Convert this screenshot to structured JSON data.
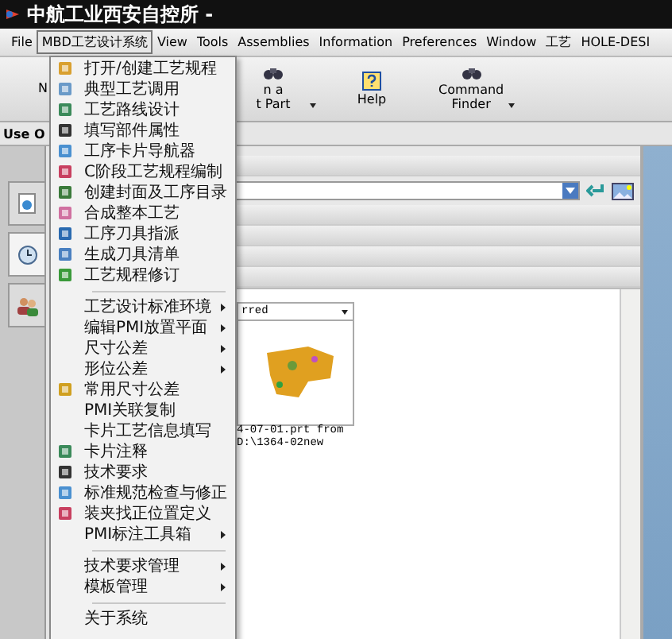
{
  "window": {
    "title": "中航工业西安自控所 -"
  },
  "menubar": [
    {
      "label": "File",
      "selected": false
    },
    {
      "label": "MBD工艺设计系统",
      "selected": true
    },
    {
      "label": "View",
      "selected": false
    },
    {
      "label": "Tools",
      "selected": false
    },
    {
      "label": "Assemblies",
      "selected": false
    },
    {
      "label": "Information",
      "selected": false
    },
    {
      "label": "Preferences",
      "selected": false
    },
    {
      "label": "Window",
      "selected": false
    },
    {
      "label": "工艺",
      "selected": false
    },
    {
      "label": "HOLE-DESI",
      "selected": false
    }
  ],
  "toolbar": [
    {
      "label": "N",
      "has_icon": false
    },
    {
      "label": "n a\nt Part",
      "has_icon": true,
      "dropdown": true
    },
    {
      "label": "Help",
      "has_icon": true,
      "dropdown": false
    },
    {
      "label": "Command\nFinder",
      "has_icon": true,
      "dropdown": true
    }
  ],
  "use_bar": {
    "label": "Use O"
  },
  "side_tabs": [
    {
      "selected": false
    },
    {
      "selected": true
    },
    {
      "selected": false
    }
  ],
  "dropdown_menu": {
    "groups": [
      [
        {
          "label": "打开/创建工艺规程",
          "has_icon": true,
          "submenu": false
        },
        {
          "label": "典型工艺调用",
          "has_icon": true,
          "submenu": false
        },
        {
          "label": "工艺路线设计",
          "has_icon": true,
          "submenu": false
        },
        {
          "label": "填写部件属性",
          "has_icon": true,
          "submenu": false
        },
        {
          "label": "工序卡片导航器",
          "has_icon": true,
          "submenu": false
        },
        {
          "label": "C阶段工艺规程编制",
          "has_icon": true,
          "submenu": false
        },
        {
          "label": "创建封面及工序目录",
          "has_icon": true,
          "submenu": false
        },
        {
          "label": "合成整本工艺",
          "has_icon": true,
          "submenu": false
        },
        {
          "label": "工序刀具指派",
          "has_icon": true,
          "submenu": false
        },
        {
          "label": "生成刀具清单",
          "has_icon": true,
          "submenu": false
        },
        {
          "label": "工艺规程修订",
          "has_icon": true,
          "submenu": false
        }
      ],
      [
        {
          "label": "工艺设计标准环境",
          "has_icon": false,
          "submenu": true
        },
        {
          "label": "编辑PMI放置平面",
          "has_icon": false,
          "submenu": true
        },
        {
          "label": "尺寸公差",
          "has_icon": false,
          "submenu": true
        },
        {
          "label": "形位公差",
          "has_icon": false,
          "submenu": true
        },
        {
          "label": "常用尺寸公差",
          "has_icon": true,
          "submenu": false
        },
        {
          "label": "PMI关联复制",
          "has_icon": false,
          "submenu": false
        },
        {
          "label": "卡片工艺信息填写",
          "has_icon": false,
          "submenu": false
        },
        {
          "label": "卡片注释",
          "has_icon": true,
          "submenu": false
        },
        {
          "label": "技术要求",
          "has_icon": true,
          "submenu": false
        },
        {
          "label": "标准规范检查与修正",
          "has_icon": true,
          "submenu": false
        },
        {
          "label": "装夹找正位置定义",
          "has_icon": true,
          "submenu": false
        },
        {
          "label": "PMI标注工具箱",
          "has_icon": false,
          "submenu": true
        }
      ],
      [
        {
          "label": "技术要求管理",
          "has_icon": false,
          "submenu": true
        },
        {
          "label": "模板管理",
          "has_icon": false,
          "submenu": true
        }
      ],
      [
        {
          "label": "关于系统",
          "has_icon": false,
          "submenu": false
        }
      ]
    ]
  },
  "preview": {
    "filter": "rred",
    "caption": "4-07-01.prt from\nD:\\1364-02new"
  }
}
